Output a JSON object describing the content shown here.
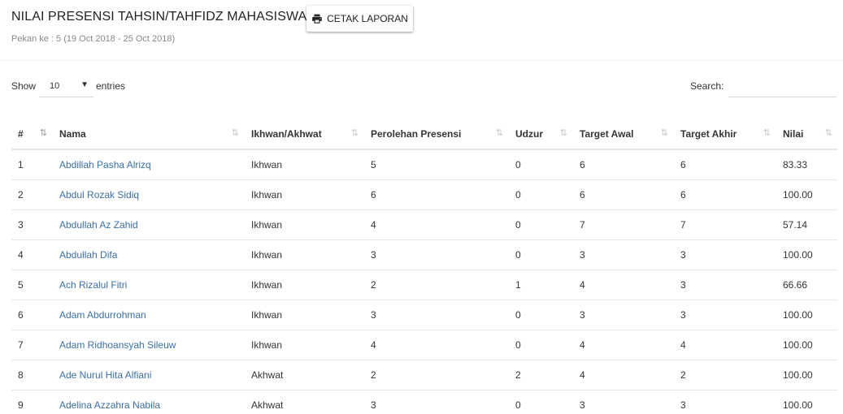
{
  "page": {
    "title": "NILAI PRESENSI TAHSIN/TAHFIDZ MAHASISWA",
    "print_label": "CETAK LAPORAN",
    "subtitle": "Pekan ke : 5 (19 Oct 2018 - 25 Oct 2018)"
  },
  "length_menu": {
    "show_label": "Show",
    "value": "10",
    "entries_label": "entries"
  },
  "search": {
    "label": "Search:",
    "value": ""
  },
  "table": {
    "columns": [
      "#",
      "Nama",
      "Ikhwan/Akhwat",
      "Perolehan Presensi",
      "Udzur",
      "Target Awal",
      "Target Akhir",
      "Nilai"
    ],
    "sorted_column": "#",
    "rows": [
      {
        "no": "1",
        "nama": "Abdillah Pasha Alrizq",
        "jenis": "Ikhwan",
        "perolehan": "5",
        "udzur": "0",
        "target_awal": "6",
        "target_akhir": "6",
        "nilai": "83.33"
      },
      {
        "no": "2",
        "nama": "Abdul Rozak Sidiq",
        "jenis": "Ikhwan",
        "perolehan": "6",
        "udzur": "0",
        "target_awal": "6",
        "target_akhir": "6",
        "nilai": "100.00"
      },
      {
        "no": "3",
        "nama": "Abdullah Az Zahid",
        "jenis": "Ikhwan",
        "perolehan": "4",
        "udzur": "0",
        "target_awal": "7",
        "target_akhir": "7",
        "nilai": "57.14"
      },
      {
        "no": "4",
        "nama": "Abdullah Difa",
        "jenis": "Ikhwan",
        "perolehan": "3",
        "udzur": "0",
        "target_awal": "3",
        "target_akhir": "3",
        "nilai": "100.00"
      },
      {
        "no": "5",
        "nama": "Ach Rizalul Fitri",
        "jenis": "Ikhwan",
        "perolehan": "2",
        "udzur": "1",
        "target_awal": "4",
        "target_akhir": "3",
        "nilai": "66.66"
      },
      {
        "no": "6",
        "nama": "Adam Abdurrohman",
        "jenis": "Ikhwan",
        "perolehan": "3",
        "udzur": "0",
        "target_awal": "3",
        "target_akhir": "3",
        "nilai": "100.00"
      },
      {
        "no": "7",
        "nama": "Adam Ridhoansyah Sileuw",
        "jenis": "Ikhwan",
        "perolehan": "4",
        "udzur": "0",
        "target_awal": "4",
        "target_akhir": "4",
        "nilai": "100.00"
      },
      {
        "no": "8",
        "nama": "Ade Nurul Hita Alfiani",
        "jenis": "Akhwat",
        "perolehan": "2",
        "udzur": "2",
        "target_awal": "4",
        "target_akhir": "2",
        "nilai": "100.00"
      },
      {
        "no": "9",
        "nama": "Adelina Azzahra Nabila",
        "jenis": "Akhwat",
        "perolehan": "3",
        "udzur": "0",
        "target_awal": "3",
        "target_akhir": "3",
        "nilai": "100.00"
      }
    ]
  },
  "icons": {
    "print": "printer-icon",
    "sort": "sort-arrows-icon",
    "caret": "caret-down-icon"
  },
  "colors": {
    "link": "#3a6fa6",
    "border": "#e6e6e6",
    "sort_icon": "#c8c8c8"
  }
}
